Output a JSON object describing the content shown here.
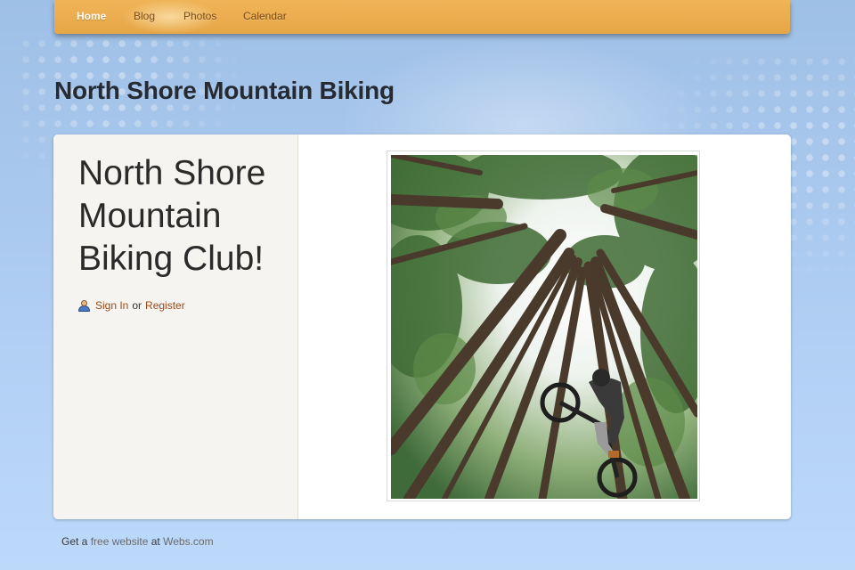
{
  "nav": {
    "items": [
      {
        "label": "Home",
        "active": true
      },
      {
        "label": "Blog",
        "active": false
      },
      {
        "label": "Photos",
        "active": false
      },
      {
        "label": "Calendar",
        "active": false
      }
    ]
  },
  "site": {
    "title": "North Shore Mountain Biking"
  },
  "sidebar": {
    "heading": "North Shore Mountain Biking Club!",
    "sign_in": "Sign In",
    "or": "or",
    "register": "Register",
    "user_icon": "user-icon"
  },
  "content": {
    "photo": "mountain-biker-jumping-among-tall-trees"
  },
  "footer": {
    "prefix": "Get a",
    "link1": "free website",
    "mid": "at",
    "link2": "Webs.com"
  },
  "colors": {
    "nav_bg": "#e6a646",
    "nav_text": "#7a4a16",
    "link": "#9a4a1a",
    "page_bg": "#a9c8ee",
    "sidebar_bg": "#f6f4f0"
  }
}
